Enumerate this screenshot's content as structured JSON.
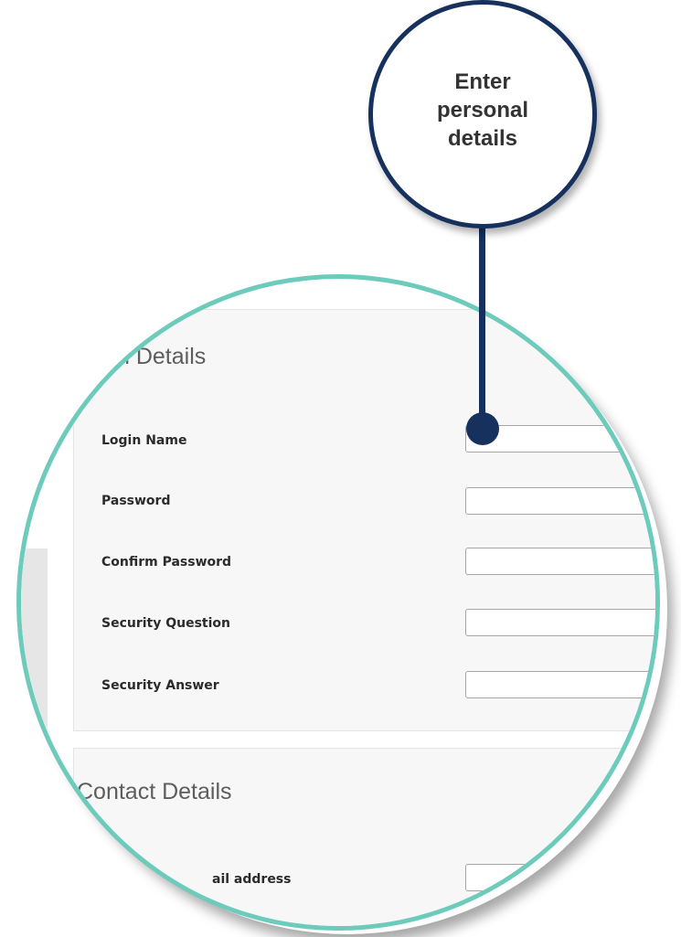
{
  "login_section": {
    "title": "n Details",
    "fields": [
      {
        "label": "Login Name",
        "value": "",
        "placeholder": ""
      },
      {
        "label": "Password",
        "value": "",
        "placeholder": ""
      },
      {
        "label": "Confirm Password",
        "value": "",
        "placeholder": ""
      },
      {
        "label": "Security Question",
        "value": "",
        "placeholder": ""
      },
      {
        "label": "Security Answer",
        "value": "",
        "placeholder": ""
      }
    ]
  },
  "contact_section": {
    "title": "Contact Details",
    "fields": [
      {
        "label": "ail address",
        "value": "",
        "placeholder": ""
      }
    ]
  },
  "callout": {
    "lines": [
      "Enter",
      "personal",
      "details"
    ]
  },
  "colors": {
    "lens_border": "#6ccbbb",
    "callout_navy": "#17315e",
    "panel_bg": "#f7f7f7"
  }
}
